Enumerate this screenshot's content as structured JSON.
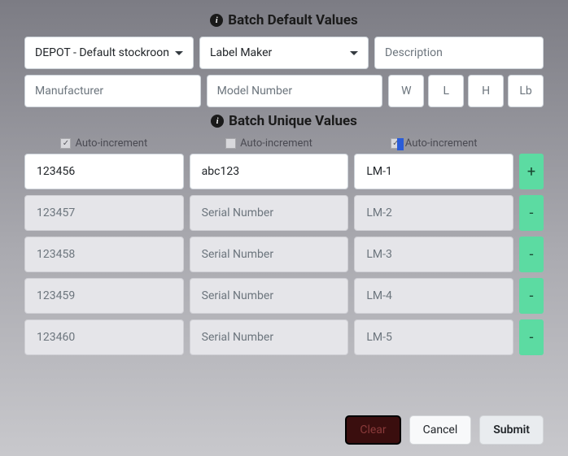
{
  "defaults": {
    "title": "Batch Default Values",
    "stockroom": "DEPOT - Default stockroom",
    "label_maker": "Label Maker",
    "description_placeholder": "Description",
    "manufacturer_placeholder": "Manufacturer",
    "model_placeholder": "Model Number",
    "dim_w": "W",
    "dim_l": "L",
    "dim_h": "H",
    "dim_lb": "Lb"
  },
  "unique": {
    "title": "Batch Unique Values",
    "auto_label": "Auto-increment",
    "autoinc": {
      "col1": true,
      "col2": false,
      "col3": true
    }
  },
  "rows": [
    {
      "a": "123456",
      "b": "abc123",
      "c": "LM-1",
      "btn": "+",
      "editable": true
    },
    {
      "a": "123457",
      "b": "Serial Number",
      "c": "LM-2",
      "btn": "-",
      "editable": false
    },
    {
      "a": "123458",
      "b": "Serial Number",
      "c": "LM-3",
      "btn": "-",
      "editable": false
    },
    {
      "a": "123459",
      "b": "Serial Number",
      "c": "LM-4",
      "btn": "-",
      "editable": false
    },
    {
      "a": "123460",
      "b": "Serial Number",
      "c": "LM-5",
      "btn": "-",
      "editable": false
    }
  ],
  "footer": {
    "clear": "Clear",
    "cancel": "Cancel",
    "submit": "Submit"
  }
}
